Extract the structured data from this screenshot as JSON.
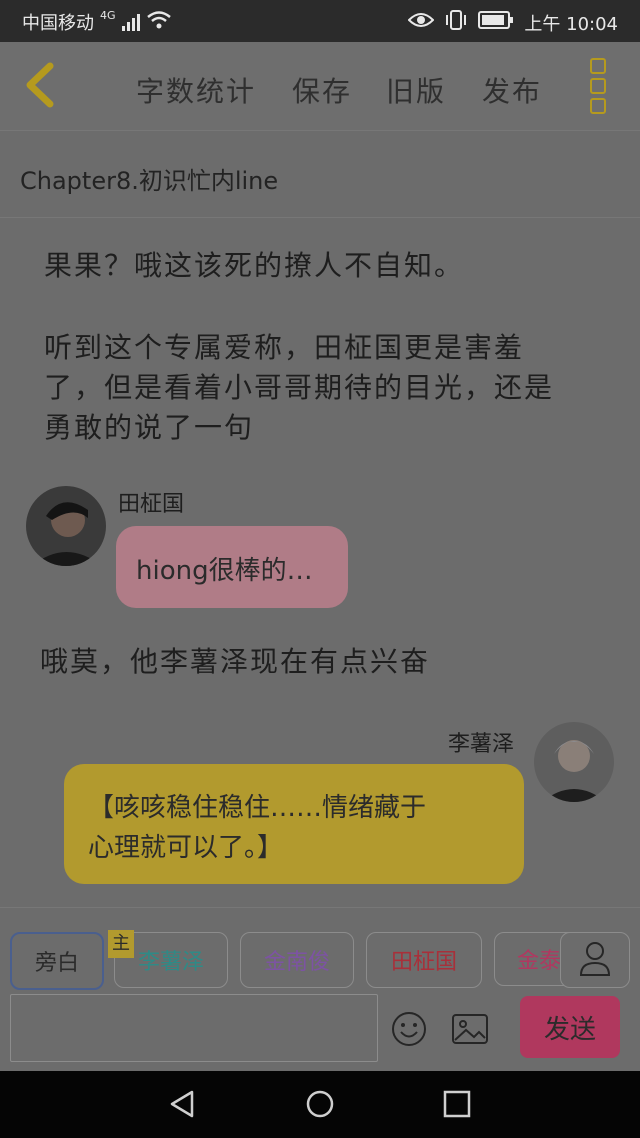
{
  "status": {
    "carrier": "中国移动",
    "network": "4G",
    "time": "上午 10:04"
  },
  "toolbar": {
    "word_count": "字数统计",
    "save": "保存",
    "old_version": "旧版",
    "publish": "发布"
  },
  "chapter": {
    "title": "Chapter8.初识忙内line"
  },
  "story": {
    "para1": "果果？哦这该死的撩人不自知。",
    "para2_line1": "听到这个专属爱称，田柾国更是害羞",
    "para2_line2": "了，但是看着小哥哥期待的目光，还是",
    "para2_line3": "勇敢的说了一句",
    "msg1_name": "田柾国",
    "msg1_text": "hiong很棒的…",
    "para3": "哦莫，他李薯泽现在有点兴奋",
    "msg2_name": "李薯泽",
    "msg2_line1": "【咳咳稳住稳住……情绪藏于",
    "msg2_line2": "心理就可以了。】"
  },
  "roles": {
    "narration": "旁白",
    "main_badge": "主",
    "role1": "李薯泽",
    "role2": "金南俊",
    "role3": "田柾国",
    "role4": "金泰"
  },
  "composer": {
    "input_placeholder": "",
    "send": "发送"
  },
  "colors": {
    "accent_yellow": "#b59a1e",
    "pink_bubble": "#b07c87",
    "yellow_bubble": "#b29a2e",
    "send_button": "#b0385e",
    "role1_color": "#2f8a86",
    "role2_color": "#7d53a3",
    "role3_color": "#a8303a",
    "role4_color": "#b03860"
  }
}
